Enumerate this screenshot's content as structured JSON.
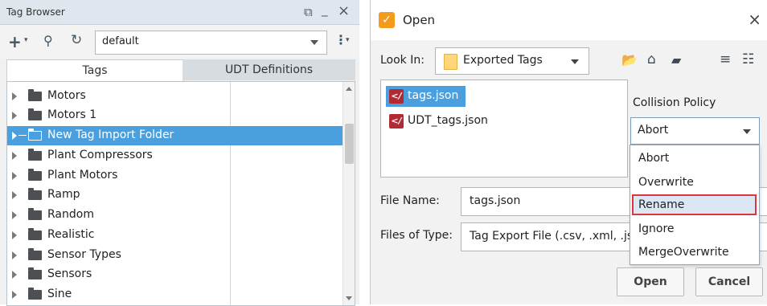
{
  "tag_browser": {
    "title": "Tag Browser",
    "window_controls": {
      "restore": "⧉",
      "minimize": "_",
      "close": "×"
    },
    "toolbar": {
      "add_icon": "plus-icon",
      "search_icon": "search-icon",
      "refresh_icon": "refresh-icon",
      "provider_value": "default",
      "menu_icon": "kebab-menu-icon"
    },
    "tabs": [
      "Tags",
      "UDT Definitions"
    ],
    "tree": [
      {
        "label": "Motors",
        "selected": false
      },
      {
        "label": "Motors 1",
        "selected": false
      },
      {
        "label": "New Tag Import Folder",
        "selected": true
      },
      {
        "label": "Plant Compressors",
        "selected": false
      },
      {
        "label": "Plant Motors",
        "selected": false
      },
      {
        "label": "Ramp",
        "selected": false
      },
      {
        "label": "Random",
        "selected": false
      },
      {
        "label": "Realistic",
        "selected": false
      },
      {
        "label": "Sensor Types",
        "selected": false
      },
      {
        "label": "Sensors",
        "selected": false
      },
      {
        "label": "Sine",
        "selected": false
      }
    ]
  },
  "open_dialog": {
    "title": "Open",
    "close_glyph": "×",
    "look_in_label": "Look In:",
    "look_in_value": "Exported Tags",
    "toolbar_icons": [
      "up-folder-icon",
      "home-icon",
      "new-folder-icon",
      "list-view-icon",
      "details-view-icon"
    ],
    "files": [
      {
        "name": "tags.json",
        "selected": true
      },
      {
        "name": "UDT_tags.json",
        "selected": false
      }
    ],
    "collision_policy_label": "Collision Policy",
    "collision_policy_value": "Abort",
    "collision_options": [
      "Abort",
      "Overwrite",
      "Rename",
      "Ignore",
      "MergeOverwrite"
    ],
    "highlighted_option": "Rename",
    "file_name_label": "File Name:",
    "file_name_value": "tags.json",
    "files_of_type_label": "Files of Type:",
    "files_of_type_value": "Tag Export File (.csv, .xml, .json)",
    "buttons": {
      "open": "Open",
      "cancel": "Cancel"
    },
    "colors": {
      "selection": "#4a9fdf",
      "highlight_border": "#e0343b",
      "logo": "#f29b1d"
    }
  }
}
